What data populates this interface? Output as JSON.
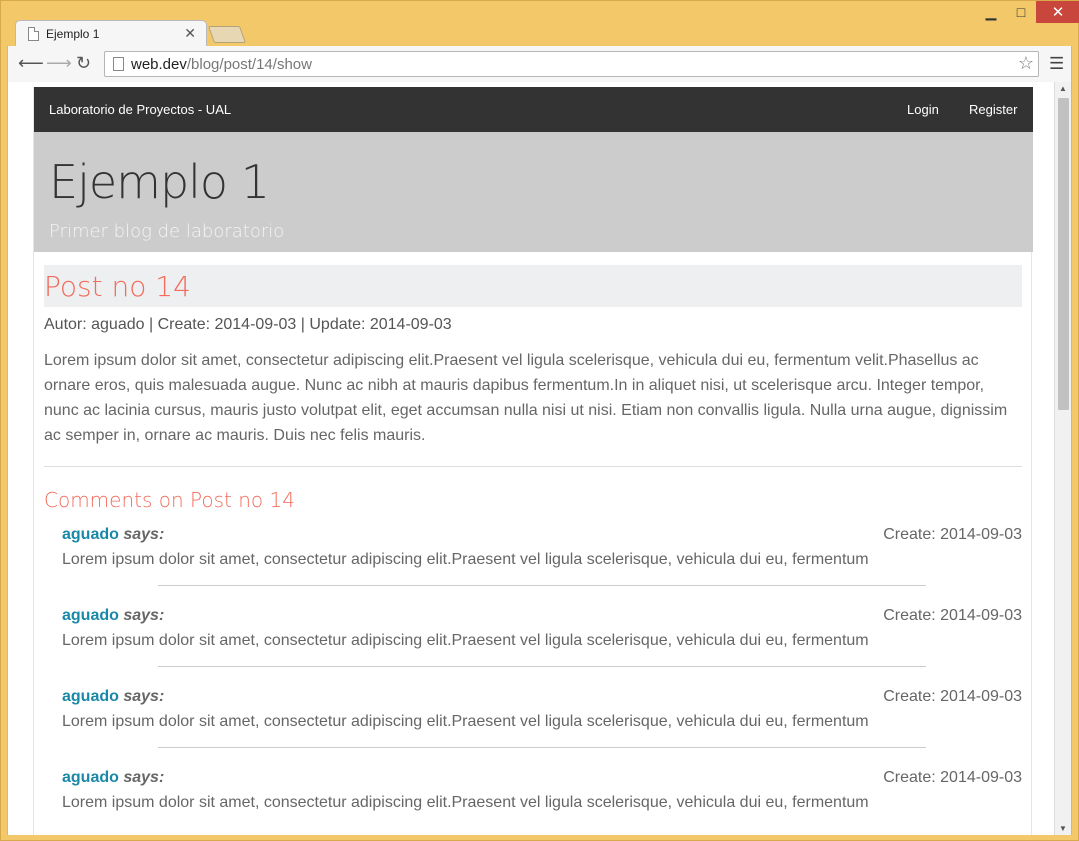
{
  "browser": {
    "tab_title": "Ejemplo 1",
    "url_host": "web.dev",
    "url_path": "/blog/post/14/show",
    "window_buttons": {
      "minimize": "▁",
      "maximize": "□",
      "close": "✕"
    }
  },
  "navbar": {
    "brand": "Laboratorio de Proyectos - UAL",
    "login": "Login",
    "register": "Register"
  },
  "jumbotron": {
    "title": "Ejemplo 1",
    "subtitle": "Primer blog de laboratorio"
  },
  "post": {
    "title": "Post no 14",
    "meta": "Autor: aguado | Create: 2014-09-03 | Update: 2014-09-03",
    "body": "Lorem ipsum dolor sit amet, consectetur adipiscing elit.Praesent vel ligula scelerisque, vehicula dui eu, fermentum velit.Phasellus ac ornare eros, quis malesuada augue. Nunc ac nibh at mauris dapibus fermentum.In in aliquet nisi, ut scelerisque arcu. Integer tempor, nunc ac lacinia cursus, mauris justo volutpat elit, eget accumsan nulla nisi ut nisi. Etiam non convallis ligula. Nulla urna augue, dignissim ac semper in, ornare ac mauris. Duis nec felis mauris."
  },
  "comments": {
    "title": "Comments on Post no 14",
    "items": [
      {
        "author": "aguado",
        "says": "says:",
        "date": "Create: 2014-09-03",
        "text": "Lorem ipsum dolor sit amet, consectetur adipiscing elit.Praesent vel ligula scelerisque, vehicula dui eu, fermentum veli"
      },
      {
        "author": "aguado",
        "says": "says:",
        "date": "Create: 2014-09-03",
        "text": "Lorem ipsum dolor sit amet, consectetur adipiscing elit.Praesent vel ligula scelerisque, vehicula dui eu, fermentum veli"
      },
      {
        "author": "aguado",
        "says": "says:",
        "date": "Create: 2014-09-03",
        "text": "Lorem ipsum dolor sit amet, consectetur adipiscing elit.Praesent vel ligula scelerisque, vehicula dui eu, fermentum veli"
      },
      {
        "author": "aguado",
        "says": "says:",
        "date": "Create: 2014-09-03",
        "text": "Lorem ipsum dolor sit amet, consectetur adipiscing elit.Praesent vel ligula scelerisque, vehicula dui eu, fermentum veli"
      }
    ]
  },
  "colors": {
    "navbar_bg": "#333333",
    "jumbotron_bg": "#cccccc",
    "accent": "#f26b5b",
    "author_link": "#1a89a8"
  },
  "icons": {
    "page": "page-icon",
    "back": "arrow-left-icon",
    "forward": "arrow-right-icon",
    "reload": "reload-icon",
    "star": "star-icon",
    "menu": "hamburger-menu-icon"
  }
}
